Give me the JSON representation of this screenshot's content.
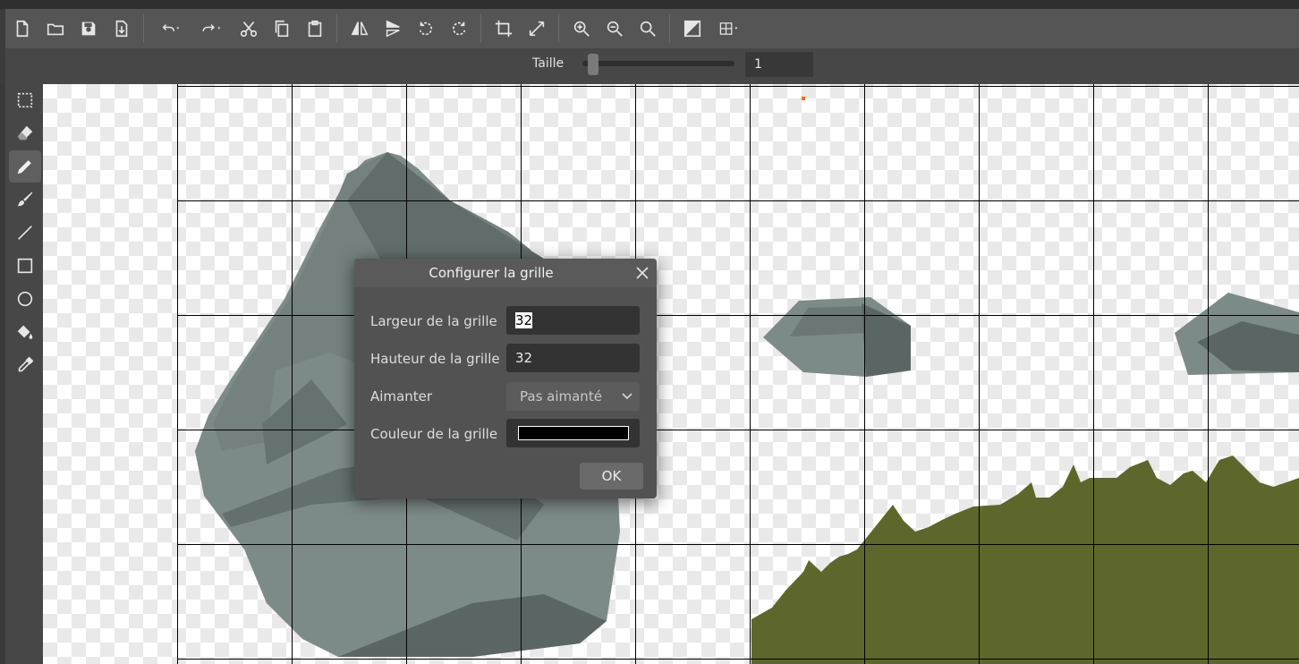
{
  "toolbar": {
    "buttons": [
      "new-file-icon",
      "open-folder-icon",
      "save-icon",
      "export-icon",
      "undo-icon",
      "redo-icon",
      "cut-icon",
      "copy-icon",
      "paste-icon",
      "flip-horizontal-icon",
      "flip-vertical-icon",
      "rotate-left-icon",
      "rotate-right-icon",
      "crop-icon",
      "resize-icon",
      "zoom-in-icon",
      "zoom-out-icon",
      "zoom-fit-icon",
      "invert-icon",
      "grid-icon"
    ]
  },
  "options": {
    "size_label": "Taille",
    "size_value": "1",
    "size_slider_fraction": 0.04
  },
  "tools": [
    "rect-select-icon",
    "eraser-icon",
    "pencil-icon",
    "brush-icon",
    "line-icon",
    "rectangle-icon",
    "ellipse-icon",
    "fill-bucket-icon",
    "eyedropper-icon"
  ],
  "active_tool": "pencil-icon",
  "dialog": {
    "title": "Configurer la grille",
    "width_label": "Largeur de la grille",
    "width_value": "32",
    "height_label": "Hauteur de la grille",
    "height_value": "32",
    "snap_label": "Aimanter",
    "snap_value": "Pas aimanté",
    "color_label": "Couleur de la grille",
    "grid_color": "#000000",
    "ok_label": "OK"
  },
  "colors": {
    "rock": "#7d8b88",
    "rock_dark": "#5b6664",
    "grass": "#5e672b",
    "grid_line": "#000000",
    "marker": "#ff6a00"
  }
}
